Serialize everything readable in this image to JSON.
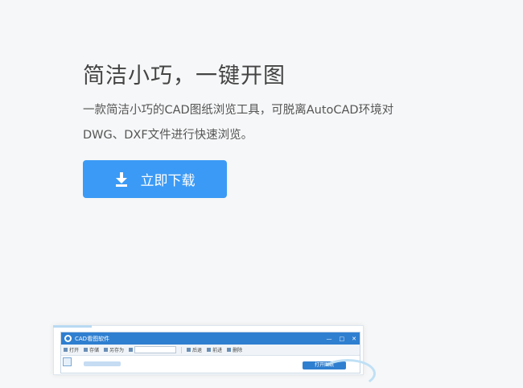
{
  "hero": {
    "title": "简洁小巧，一键开图",
    "description_line1": "一款简洁小巧的CAD图纸浏览工具，可脱离AutoCAD环境对",
    "description_line2": "DWG、DXF文件进行快速浏览。",
    "download_label": "立即下载",
    "download_icon": "download-icon",
    "button_color": "#3b9af5"
  },
  "preview": {
    "window_title": "CAD看图软件",
    "window_controls": [
      "—",
      "□",
      "✕"
    ],
    "toolbar": {
      "open": "打开",
      "save": "存储",
      "save_as": "另存为",
      "back": "后退",
      "forward": "前进",
      "delete": "删除"
    },
    "open_button_label": "打开图纸",
    "accent_color": "#2f7fd0"
  }
}
